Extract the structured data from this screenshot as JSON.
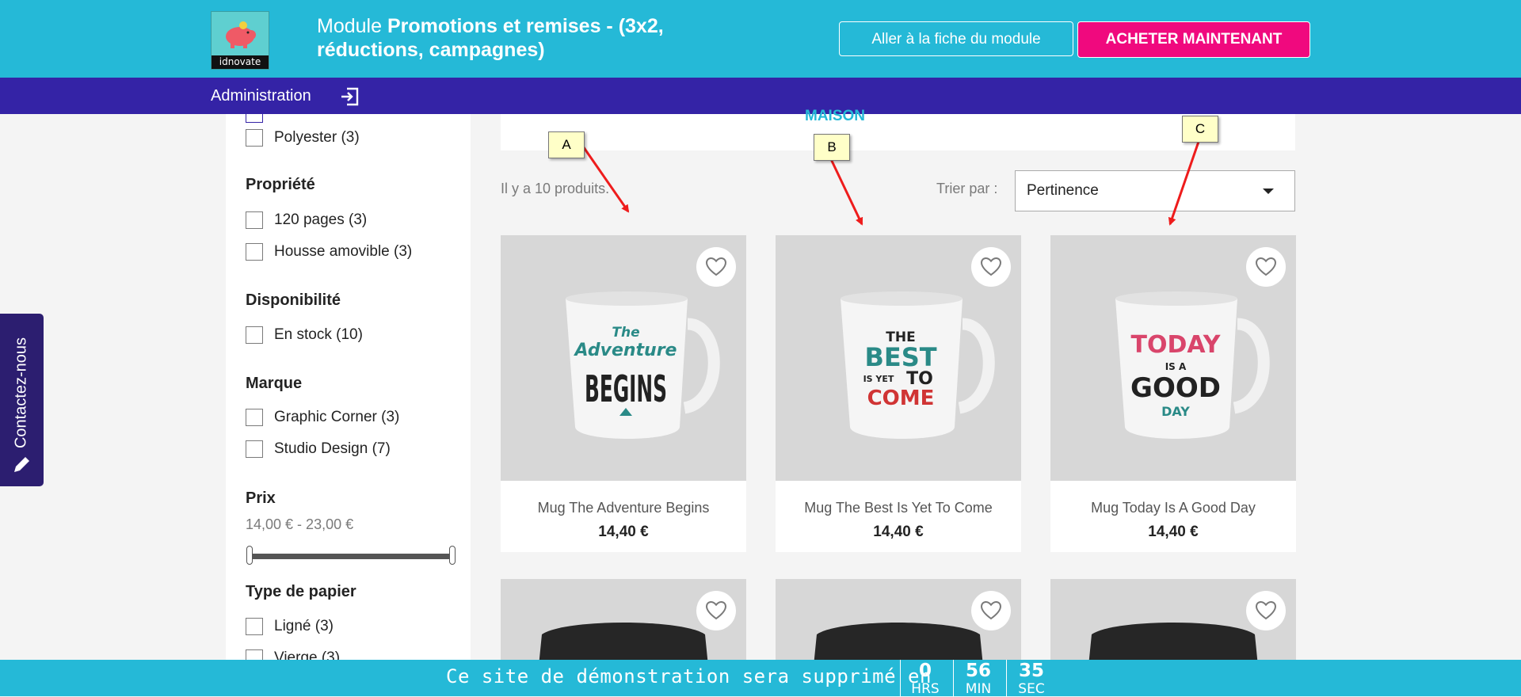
{
  "header": {
    "logo_text": "idnovate",
    "title_prefix": "Module ",
    "title_bold": "Promotions et remises - (3x2, réductions, campagnes)",
    "module_button": "Aller à la fiche du module",
    "buy_button": "ACHETER MAINTENANT"
  },
  "adminbar": {
    "label": "Administration",
    "icon": "logout-icon"
  },
  "contact": {
    "label": "Contactez-nous",
    "icon": "pencil-icon"
  },
  "filters": {
    "material_item": "Polyester (3)",
    "property": {
      "title": "Propriété",
      "items": [
        "120 pages (3)",
        "Housse amovible (3)"
      ]
    },
    "availability": {
      "title": "Disponibilité",
      "items": [
        "En stock (10)"
      ]
    },
    "brand": {
      "title": "Marque",
      "items": [
        "Graphic Corner (3)",
        "Studio Design (7)"
      ]
    },
    "price": {
      "title": "Prix",
      "range": "14,00 € - 23,00 €",
      "min": 14,
      "max": 23
    },
    "paper": {
      "title": "Type de papier",
      "items": [
        "Ligné (3)",
        "Vierge (3)"
      ]
    }
  },
  "category": "MAISON",
  "listing": {
    "count_text": "Il y a 10 produits.",
    "sort_label": "Trier par :",
    "sort_value": "Pertinence"
  },
  "products": [
    {
      "name": "Mug The Adventure Begins",
      "price": "14,40 €",
      "mug_text": [
        "The",
        "Adventure",
        "BEGINS"
      ]
    },
    {
      "name": "Mug The Best Is Yet To Come",
      "price": "14,40 €",
      "mug_text": [
        "THE",
        "BEST",
        "IS YET",
        "TO",
        "COME"
      ]
    },
    {
      "name": "Mug Today Is A Good Day",
      "price": "14,40 €",
      "mug_text": [
        "TODAY",
        "IS A",
        "GOOD",
        "DAY"
      ]
    }
  ],
  "annotations": [
    "A",
    "B",
    "C"
  ],
  "demo_bar": {
    "message": "Ce site de démonstration sera supprimé en",
    "hours": "0",
    "hours_unit": "HRS",
    "minutes": "56",
    "minutes_unit": "MIN",
    "seconds": "35",
    "seconds_unit": "SEC"
  },
  "colors": {
    "cyan": "#25b9d7",
    "indigo": "#3423a6",
    "pink": "#f0097e",
    "contact": "#2c1e70"
  }
}
